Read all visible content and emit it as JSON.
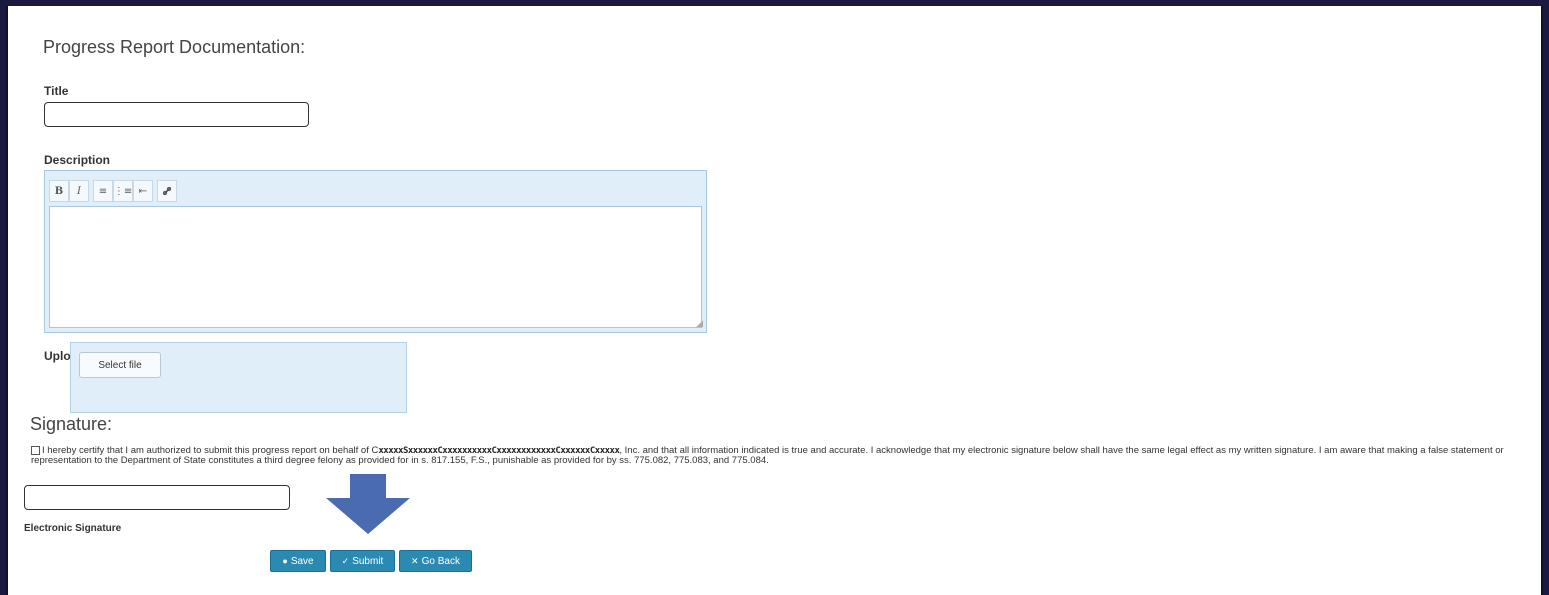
{
  "form": {
    "section_title": "Progress Report Documentation:",
    "title_label": "Title",
    "title_value": "",
    "description_label": "Description",
    "description_value": "",
    "toolbar": {
      "bold": "B",
      "italic": "I",
      "bullet_list": "≡",
      "numbered_list": "⋮≡",
      "outdent": "⇤",
      "link": "🔗"
    },
    "upload_label": "Upload a file",
    "select_file": "Select file"
  },
  "signature": {
    "heading": "Signature:",
    "cert_part1": "I hereby certify that I am authorized to submit this progress report on behalf of C",
    "cert_redacted": "xxxxxSxxxxxxCxxxxxxxxxxCxxxxxxxxxxxxCxxxxxxCxxxxx",
    "cert_part2": ", Inc. and that all information indicated is true and accurate. I acknowledge that my electronic signature below shall have the same legal effect as my written signature. I am aware that making a false statement or representation to the Department of State constitutes a third degree felony as provided for in s. 817.155, F.S., punishable as provided for by ss. 775.082, 775.083, and 775.084.",
    "checkbox_checked": false,
    "signature_value": "",
    "signature_label": "Electronic Signature"
  },
  "buttons": {
    "save": "Save",
    "submit": "Submit",
    "go_back": "Go Back"
  },
  "colors": {
    "button_bg": "#2a8ab2",
    "arrow": "#4a6bb0",
    "frame_bg": "#1a1a40"
  }
}
